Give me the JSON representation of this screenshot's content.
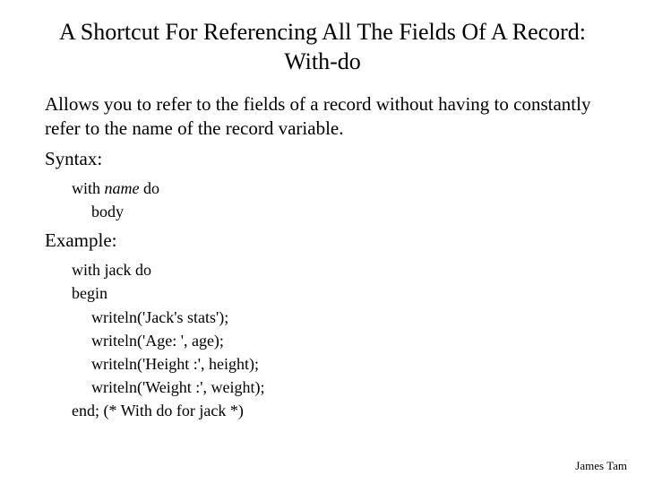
{
  "title": "A Shortcut For Referencing All The Fields Of A Record: With-do",
  "description": "Allows you to refer to the fields of a record without having to constantly refer to the name of the record variable.",
  "syntax_label": "Syntax:",
  "syntax": {
    "with_kw": "with ",
    "name": "name",
    "do_kw": " do",
    "body": "body"
  },
  "example_label": "Example:",
  "example": {
    "line1": "with jack do",
    "line2": "begin",
    "line3": "writeln('Jack's stats');",
    "line4": "writeln('Age: ', age);",
    "line5": "writeln('Height :', height);",
    "line6": "writeln('Weight :', weight);",
    "line7": "end; (* With do for jack *)"
  },
  "footer": "James Tam"
}
